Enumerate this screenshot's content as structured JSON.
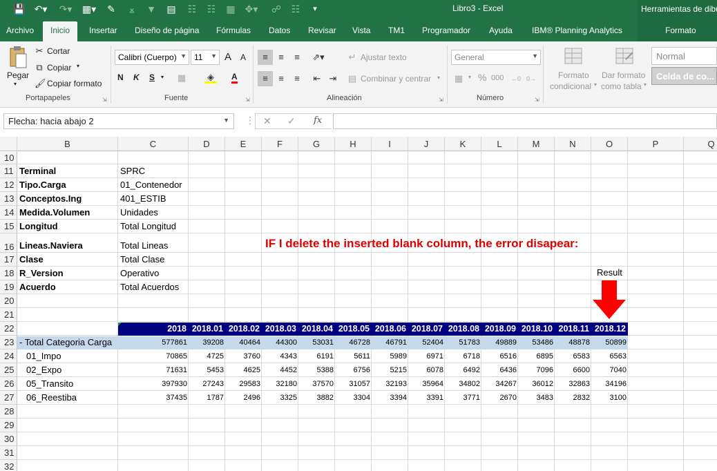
{
  "titlebar": {
    "app_title": "Libro3  -  Excel",
    "context_title": "Herramientas de dibujo"
  },
  "tabs": [
    "Archivo",
    "Inicio",
    "Insertar",
    "Diseño de página",
    "Fórmulas",
    "Datos",
    "Revisar",
    "Vista",
    "TM1",
    "Programador",
    "Ayuda",
    "IBM® Planning Analytics"
  ],
  "context_tab": "Formato",
  "ribbon": {
    "clipboard": {
      "paste": "Pegar",
      "cut": "Cortar",
      "copy": "Copiar",
      "format_painter": "Copiar formato",
      "group": "Portapapeles"
    },
    "font": {
      "name": "Calibri (Cuerpo)",
      "size": "11",
      "bold": "N",
      "italic": "K",
      "underline": "S",
      "grow": "A",
      "shrink": "A",
      "group": "Fuente"
    },
    "alignment": {
      "wrap": "Ajustar texto",
      "merge": "Combinar y centrar",
      "group": "Alineación"
    },
    "number": {
      "format": "General",
      "percent": "%",
      "thousands": "000",
      "group": "Número"
    },
    "styles": {
      "cond_format_1": "Formato",
      "cond_format_2": "condicional",
      "table_format_1": "Dar formato",
      "table_format_2": "como tabla",
      "normal": "Normal",
      "celda": "Celda de co..."
    }
  },
  "formula_bar": {
    "name_box": "Flecha: hacia abajo 2",
    "fx": "fx",
    "formula": ""
  },
  "columns": [
    "B",
    "C",
    "D",
    "E",
    "F",
    "G",
    "H",
    "I",
    "J",
    "K",
    "L",
    "M",
    "N",
    "O",
    "P",
    "Q"
  ],
  "rows": [
    "10",
    "11",
    "12",
    "13",
    "14",
    "15",
    "16",
    "17",
    "18",
    "19",
    "20",
    "21",
    "22",
    "23",
    "24",
    "25",
    "26",
    "27",
    "28",
    "29",
    "30",
    "31",
    "32"
  ],
  "labels": [
    {
      "name": "Terminal",
      "value": "SPRC"
    },
    {
      "name": "Tipo.Carga",
      "value": "01_Contenedor"
    },
    {
      "name": "Conceptos.Ing",
      "value": "401_ESTIB"
    },
    {
      "name": "Medida.Volumen",
      "value": "Unidades"
    },
    {
      "name": "Longitud",
      "value": "Total Longitud"
    },
    {
      "name": "Lineas.Naviera",
      "value": "Total Lineas"
    },
    {
      "name": "Clase",
      "value": "Total Clase"
    },
    {
      "name": "R_Version",
      "value": "Operativo"
    },
    {
      "name": "Acuerdo",
      "value": "Total Acuerdos"
    }
  ],
  "annotation": "IF I delete the inserted blank column, the error disapear:",
  "result_label": "Result",
  "table": {
    "headers": [
      "2018",
      "2018.01",
      "2018.02",
      "2018.03",
      "2018.04",
      "2018.05",
      "2018.06",
      "2018.07",
      "2018.08",
      "2018.09",
      "2018.10",
      "2018.11",
      "2018.12"
    ],
    "rows": [
      {
        "label": "- Total Categoria Carga",
        "values": [
          "577861",
          "39208",
          "40464",
          "44300",
          "53031",
          "46728",
          "46791",
          "52404",
          "51783",
          "49889",
          "53486",
          "48878",
          "50899"
        ]
      },
      {
        "label": "01_Impo",
        "values": [
          "70865",
          "4725",
          "3760",
          "4343",
          "6191",
          "5611",
          "5989",
          "6971",
          "6718",
          "6516",
          "6895",
          "6583",
          "6563"
        ]
      },
      {
        "label": "02_Expo",
        "values": [
          "71631",
          "5453",
          "4625",
          "4452",
          "5388",
          "6756",
          "5215",
          "6078",
          "6492",
          "6436",
          "7096",
          "6600",
          "7040"
        ]
      },
      {
        "label": "05_Transito",
        "values": [
          "397930",
          "27243",
          "29583",
          "32180",
          "37570",
          "31057",
          "32193",
          "35964",
          "34802",
          "34267",
          "36012",
          "32863",
          "34196"
        ]
      },
      {
        "label": "06_Reestiba",
        "values": [
          "37435",
          "1787",
          "2496",
          "3325",
          "3882",
          "3304",
          "3394",
          "3391",
          "3771",
          "2670",
          "3483",
          "2832",
          "3100"
        ]
      }
    ]
  },
  "colors": {
    "excel_green": "#217346",
    "header_navy": "#000080",
    "total_band": "#c5d9ec",
    "annotation_red": "#e00000",
    "arrow_red": "#ff0000"
  }
}
